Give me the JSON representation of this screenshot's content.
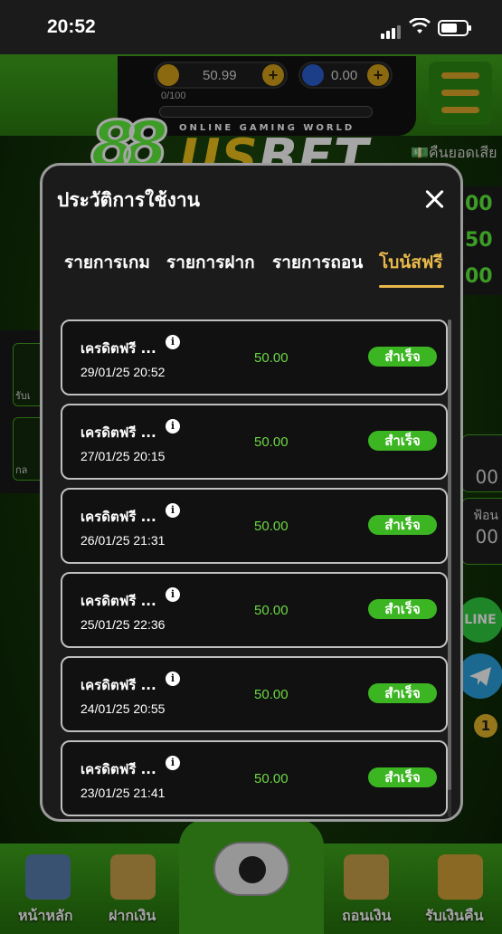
{
  "status_bar": {
    "time": "20:52"
  },
  "header": {
    "balance": "50.99",
    "coins": "0.00",
    "progress_text": "0/100",
    "progress": 0.0,
    "logo_text_prefix": "88",
    "logo_text_us": "US",
    "logo_text_bet": "BET",
    "tagline": "ONLINE GAMING WORLD",
    "cashback_label": "คืนยอดเสีย"
  },
  "background": {
    "left_item_1": "รับเ",
    "left_item_2": "กล",
    "right_values": [
      "00",
      "50",
      "00"
    ],
    "right_block_1": "00",
    "right_block_2_label": "ฟ้อน",
    "right_block_2_value": "00",
    "line_label": "LINE",
    "notification_count": "1"
  },
  "modal": {
    "title": "ประวัติการใช้งาน",
    "tabs": [
      {
        "label": "รายการเกม",
        "active": false
      },
      {
        "label": "รายการฝาก",
        "active": false
      },
      {
        "label": "รายการถอน",
        "active": false
      },
      {
        "label": "โบนัสฟรี",
        "active": true
      }
    ],
    "rows": [
      {
        "name": "เครดิตฟรี ...",
        "date": "29/01/25 20:52",
        "amount": "50.00",
        "status": "สำเร็จ"
      },
      {
        "name": "เครดิตฟรี ...",
        "date": "27/01/25 20:15",
        "amount": "50.00",
        "status": "สำเร็จ"
      },
      {
        "name": "เครดิตฟรี ...",
        "date": "26/01/25 21:31",
        "amount": "50.00",
        "status": "สำเร็จ"
      },
      {
        "name": "เครดิตฟรี ...",
        "date": "25/01/25 22:36",
        "amount": "50.00",
        "status": "สำเร็จ"
      },
      {
        "name": "เครดิตฟรี ...",
        "date": "24/01/25 20:55",
        "amount": "50.00",
        "status": "สำเร็จ"
      },
      {
        "name": "เครดิตฟรี ...",
        "date": "23/01/25 21:41",
        "amount": "50.00",
        "status": "สำเร็จ"
      }
    ]
  },
  "bottom_nav": {
    "home": "หน้าหลัก",
    "deposit": "ฝากเงิน",
    "withdraw": "ถอนเงิน",
    "cashback": "รับเงินคืน"
  }
}
